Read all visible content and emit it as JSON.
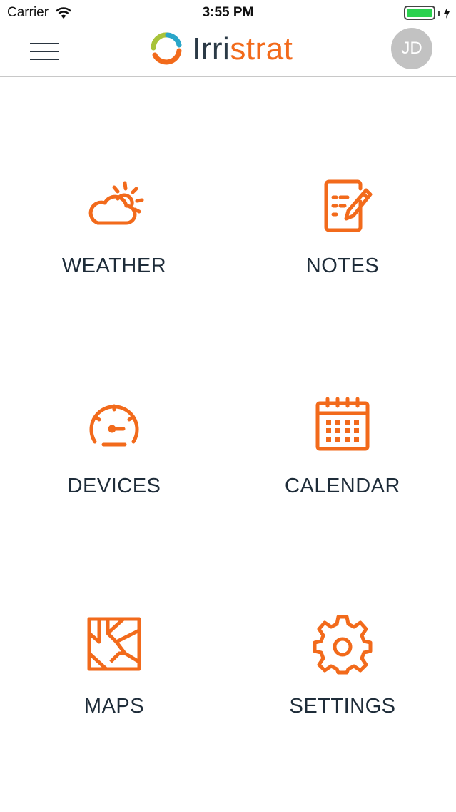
{
  "status_bar": {
    "carrier": "Carrier",
    "time": "3:55 PM",
    "battery_level": 1.0,
    "battery_color": "#2bd14f"
  },
  "header": {
    "menu_icon": "hamburger-menu-icon",
    "logo": {
      "part1": "Irri",
      "part2": "strat"
    },
    "avatar_initials": "JD"
  },
  "colors": {
    "accent": "#f26a1b",
    "text": "#1e2c39",
    "avatar_bg": "#c2c2c2"
  },
  "tiles": [
    {
      "label": "WEATHER",
      "icon": "weather-icon"
    },
    {
      "label": "NOTES",
      "icon": "notes-icon"
    },
    {
      "label": "DEVICES",
      "icon": "gauge-icon"
    },
    {
      "label": "CALENDAR",
      "icon": "calendar-icon"
    },
    {
      "label": "MAPS",
      "icon": "map-icon"
    },
    {
      "label": "SETTINGS",
      "icon": "gear-icon"
    }
  ]
}
